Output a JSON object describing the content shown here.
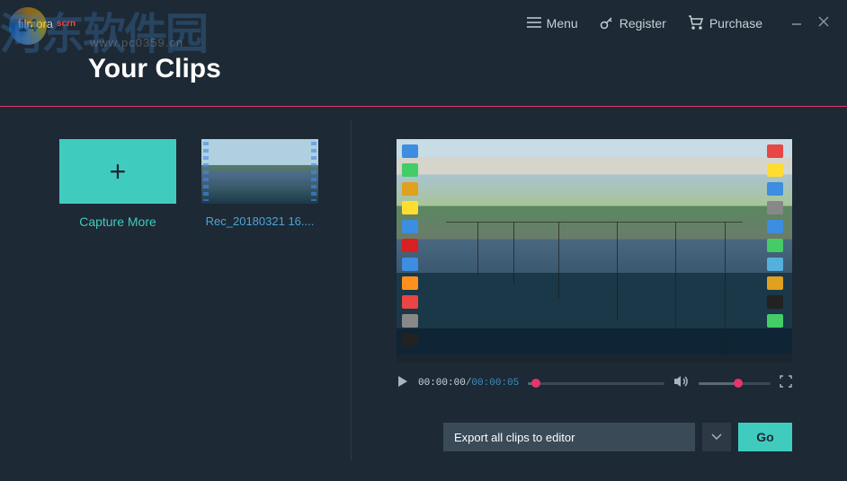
{
  "header": {
    "logo_main": "filmora",
    "logo_accent": "scrn",
    "menu_label": "Menu",
    "register_label": "Register",
    "purchase_label": "Purchase"
  },
  "watermark": {
    "text": "河东软件园",
    "sub": "www.pc0359.cn"
  },
  "page": {
    "title": "Your Clips"
  },
  "clips": {
    "capture_more_label": "Capture More",
    "items": [
      {
        "name": "Rec_20180321 16...."
      }
    ]
  },
  "player": {
    "current_time": "00:00:00",
    "total_time": "00:00:05",
    "progress_percent": 6,
    "volume_percent": 55
  },
  "export": {
    "selected": "Export all clips to editor",
    "go_label": "Go"
  }
}
